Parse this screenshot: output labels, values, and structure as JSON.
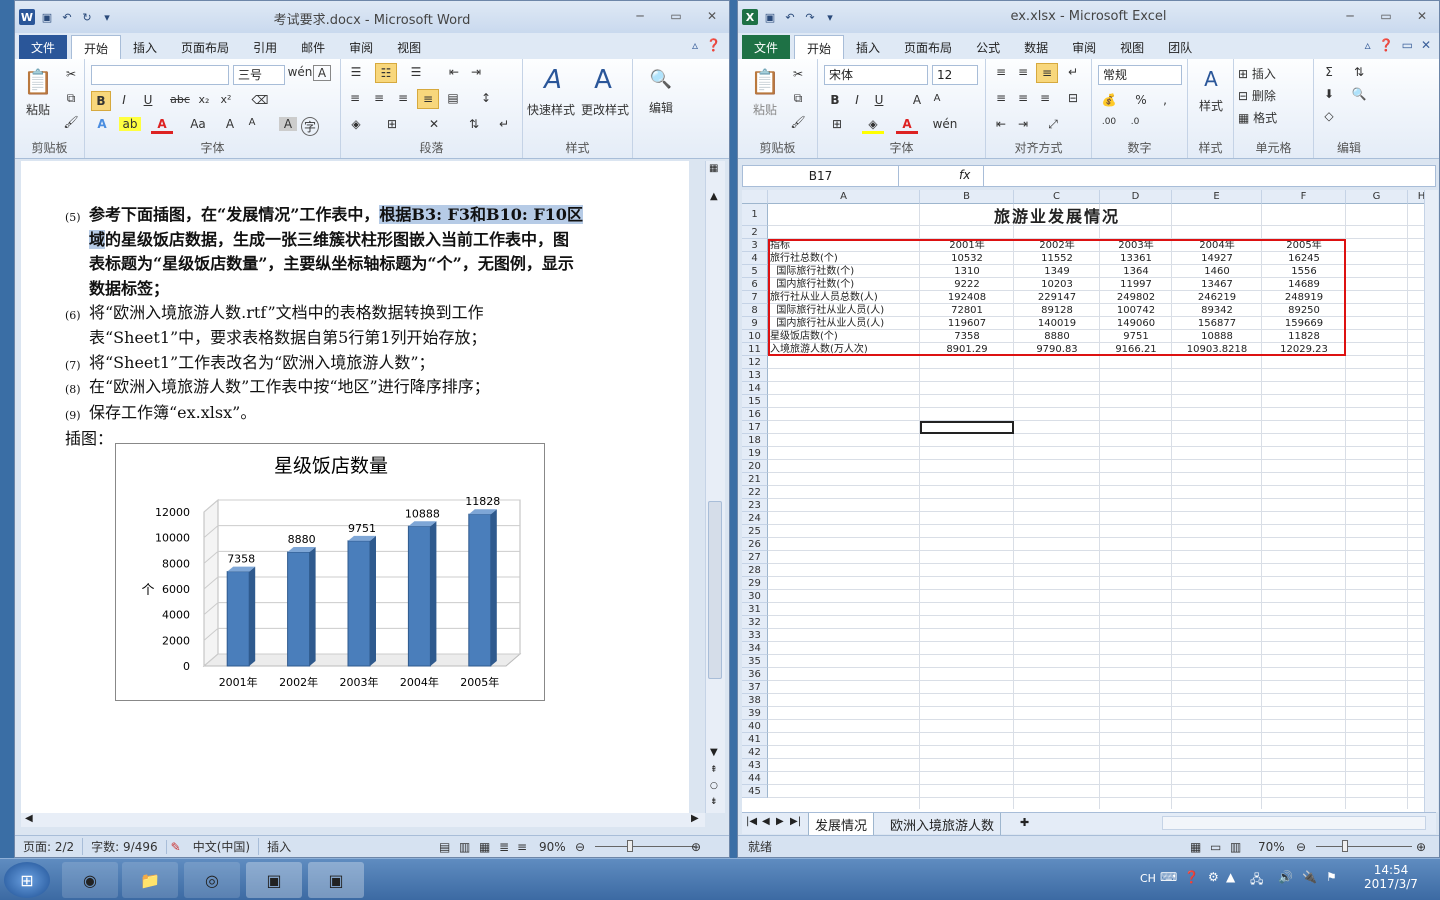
{
  "word": {
    "title": "考试要求.docx - Microsoft Word",
    "app_icon": "W",
    "tabs": [
      "文件",
      "开始",
      "插入",
      "页面布局",
      "引用",
      "邮件",
      "审阅",
      "视图"
    ],
    "active_tab": "开始",
    "font_name": "",
    "font_size": "三号",
    "groups": {
      "clipboard": "剪贴板",
      "font": "字体",
      "paragraph": "段落",
      "styles": "样式"
    },
    "paste_label": "粘贴",
    "quick_style_label": "快速样式",
    "change_style_label": "更改样式",
    "edit_label": "编辑",
    "items": [
      {
        "num": "(5)",
        "parts": [
          {
            "t": "参考下面插图，在“发展情况”工作表中，",
            "b": true,
            "h": false
          },
          {
            "t": "根据B3: F3和B10: F10区域",
            "b": true,
            "h": true
          },
          {
            "t": "的星级饭店数据，生成一张三维簇状柱形图嵌入当前工作表中，图表标题为“星级饭店数量”，主要纵坐标轴标题为“个”，无图例，显示数据标签；",
            "b": true,
            "h": false
          }
        ]
      },
      {
        "num": "(6)",
        "parts": [
          {
            "t": "将“欧洲入境旅游人数.rtf”文档中的表格数据转换到工作表“Sheet1”中，要求表格数据自第5行第1列开始存放；",
            "b": false,
            "h": false
          }
        ]
      },
      {
        "num": "(7)",
        "parts": [
          {
            "t": "将“Sheet1”工作表改名为“欧洲入境旅游人数”；",
            "b": false,
            "h": false
          }
        ]
      },
      {
        "num": "(8)",
        "parts": [
          {
            "t": "在“欧洲入境旅游人数”工作表中按“地区”进行降序排序；",
            "b": false,
            "h": false
          }
        ]
      },
      {
        "num": "(9)",
        "parts": [
          {
            "t": "保存工作簿“ex.xlsx”。",
            "b": false,
            "h": false
          }
        ]
      }
    ],
    "figure_label": "插图：",
    "status": {
      "page": "页面: 2/2",
      "words": "字数: 9/496",
      "lang": "中文(中国)",
      "mode": "插入",
      "zoom": "90%"
    }
  },
  "chart_data": {
    "type": "bar",
    "title": "星级饭店数量",
    "categories": [
      "2001年",
      "2002年",
      "2003年",
      "2004年",
      "2005年"
    ],
    "values": [
      7358,
      8880,
      9751,
      10888,
      11828
    ],
    "ylabel": "个",
    "xlabel": "",
    "ylim": [
      0,
      12000
    ],
    "yticks": [
      "0",
      "2000",
      "4000",
      "6000",
      "8000",
      "10000",
      "12000"
    ],
    "data_labels": [
      "7358",
      "8880",
      "9751",
      "10888",
      "11828"
    ],
    "legend": "none",
    "grid": true,
    "color": "#4a7ebb"
  },
  "excel": {
    "title": "ex.xlsx - Microsoft Excel",
    "app_icon": "X",
    "tabs": [
      "文件",
      "开始",
      "插入",
      "页面布局",
      "公式",
      "数据",
      "审阅",
      "视图",
      "团队"
    ],
    "active_tab": "开始",
    "font_name": "宋体",
    "font_size": "12",
    "number_format": "常规",
    "groups": {
      "clipboard": "剪贴板",
      "font": "字体",
      "align": "对齐方式",
      "number": "数字",
      "styles": "样式",
      "cells": "单元格",
      "edit": "编辑"
    },
    "paste_label": "粘贴",
    "style_label": "样式",
    "insert_label": "插入",
    "delete_label": "删除",
    "format_label": "格式",
    "name_box": "B17",
    "fx": "fx",
    "formula": "",
    "columns": [
      "A",
      "B",
      "C",
      "D",
      "E",
      "F",
      "G",
      "H"
    ],
    "sheet_title": "旅游业发展情况",
    "table": [
      [
        "指标",
        "2001年",
        "2002年",
        "2003年",
        "2004年",
        "2005年"
      ],
      [
        "旅行社总数(个)",
        "10532",
        "11552",
        "13361",
        "14927",
        "16245"
      ],
      [
        "  国际旅行社数(个)",
        "1310",
        "1349",
        "1364",
        "1460",
        "1556"
      ],
      [
        "  国内旅行社数(个)",
        "9222",
        "10203",
        "11997",
        "13467",
        "14689"
      ],
      [
        "旅行社从业人员总数(人)",
        "192408",
        "229147",
        "249802",
        "246219",
        "248919"
      ],
      [
        "  国际旅行社从业人员(人)",
        "72801",
        "89128",
        "100742",
        "89342",
        "89250"
      ],
      [
        "  国内旅行社从业人员(人)",
        "119607",
        "140019",
        "149060",
        "156877",
        "159669"
      ],
      [
        "星级饭店数(个)",
        "7358",
        "8880",
        "9751",
        "10888",
        "11828"
      ],
      [
        "入境旅游人数(万人次)",
        "8901.29",
        "9790.83",
        "9166.21",
        "10903.8218",
        "12029.23"
      ]
    ],
    "sheets": [
      "发展情况",
      "欧洲入境旅游人数"
    ],
    "status": {
      "ready": "就绪",
      "zoom": "70%"
    }
  },
  "taskbar": {
    "clock_time": "14:54",
    "clock_date": "2017/3/7",
    "lang": "CH"
  }
}
